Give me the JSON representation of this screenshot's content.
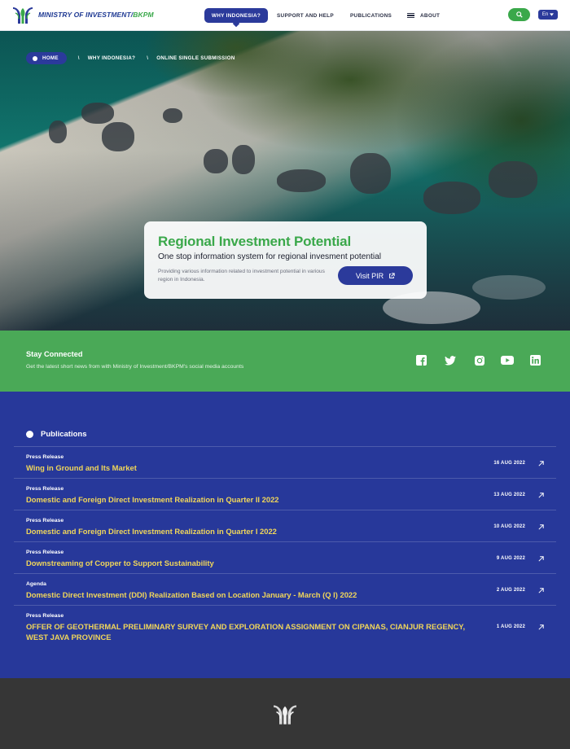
{
  "header": {
    "brand_main": "MINISTRY OF INVESTMENT/",
    "brand_accent": "BKPM",
    "logo_icon": "bkpm-logo-icon",
    "nav": {
      "why_indonesia": "WHY INDONESIA?",
      "support": "SUPPORT AND HELP",
      "publications": "PUBLICATIONS",
      "about": "ABOUT"
    },
    "search_icon": "search-icon",
    "language": "En",
    "colors": {
      "brand_blue": "#2b3a9b",
      "brand_green": "#3aa84a"
    }
  },
  "breadcrumb": {
    "items": [
      "HOME",
      "WHY INDONESIA?",
      "ONLINE SINGLE SUBMISSION"
    ],
    "separator": "\\"
  },
  "hero_card": {
    "title": "Regional Investment Potential",
    "subtitle": "One stop information system for regional invesment potential",
    "description": "Providing various information related to investment potential in various region in Indonesia.",
    "button_label": "Visit PIR"
  },
  "stay_connected": {
    "title": "Stay Connected",
    "description": "Get the latest short news from with Ministry of Investment/BKPM's social media accounts",
    "social_icons": [
      "facebook-icon",
      "twitter-icon",
      "instagram-icon",
      "youtube-icon",
      "linkedin-icon"
    ]
  },
  "publications": {
    "heading": "Publications",
    "items": [
      {
        "category": "Press Release",
        "title": "Wing in Ground and Its Market",
        "date": "16 AUG 2022"
      },
      {
        "category": "Press Release",
        "title": "Domestic and Foreign Direct Investment Realization in Quarter II 2022",
        "date": "13 AUG 2022"
      },
      {
        "category": "Press Release",
        "title": "Domestic and Foreign Direct Investment Realization in Quarter I 2022",
        "date": "10 AUG 2022"
      },
      {
        "category": "Press Release",
        "title": "Downstreaming of Copper to Support Sustainability",
        "date": "9 AUG 2022"
      },
      {
        "category": "Agenda",
        "title": "Domestic Direct Investment (DDI) Realization Based on Location January - March (Q I) 2022",
        "date": "2 AUG 2022"
      },
      {
        "category": "Press Release",
        "title": "OFFER OF GEOTHERMAL PRELIMINARY SURVEY AND EXPLORATION ASSIGNMENT ON CIPANAS, CIANJUR REGENCY, WEST JAVA PROVINCE",
        "date": "1 AUG 2022"
      }
    ]
  },
  "footer": {
    "logo_icon": "bkpm-logo-icon"
  }
}
